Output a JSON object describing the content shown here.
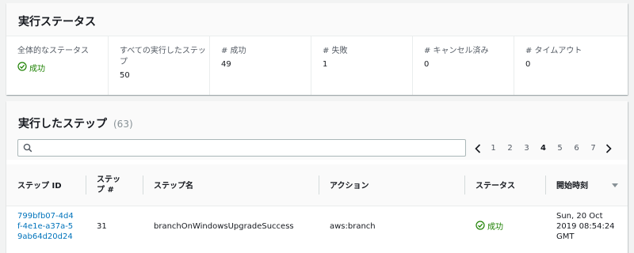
{
  "status_panel": {
    "title": "実行ステータス",
    "stats": [
      {
        "label": "全体的なステータス",
        "value": "成功",
        "kind": "success"
      },
      {
        "label": "すべての実行したステップ",
        "value": "50"
      },
      {
        "label": "# 成功",
        "value": "49"
      },
      {
        "label": "# 失敗",
        "value": "1"
      },
      {
        "label": "# キャンセル済み",
        "value": "0"
      },
      {
        "label": "# タイムアウト",
        "value": "0"
      }
    ]
  },
  "steps_panel": {
    "title": "実行したステップ",
    "count": "(63)",
    "search": {
      "placeholder": "",
      "value": ""
    },
    "pagination": {
      "pages": [
        "1",
        "2",
        "3",
        "4",
        "5",
        "6",
        "7"
      ],
      "current": "4"
    },
    "columns": [
      "ステップ ID",
      "ステップ #",
      "ステップ名",
      "アクション",
      "ステータス",
      "開始時刻"
    ],
    "rows": [
      {
        "id": "799bfb07-4d4f-4e1e-a37a-59ab64d20d24",
        "step_no": "31",
        "name": "branchOnWindowsUpgradeSuccess",
        "action": "aws:branch",
        "status": "成功",
        "start_time": "Sun, 20 Oct 2019 08:54:24 GMT"
      }
    ]
  },
  "colors": {
    "success": "#1d8102",
    "link": "#0073bb",
    "text": "#16191f",
    "muted": "#545b64"
  }
}
